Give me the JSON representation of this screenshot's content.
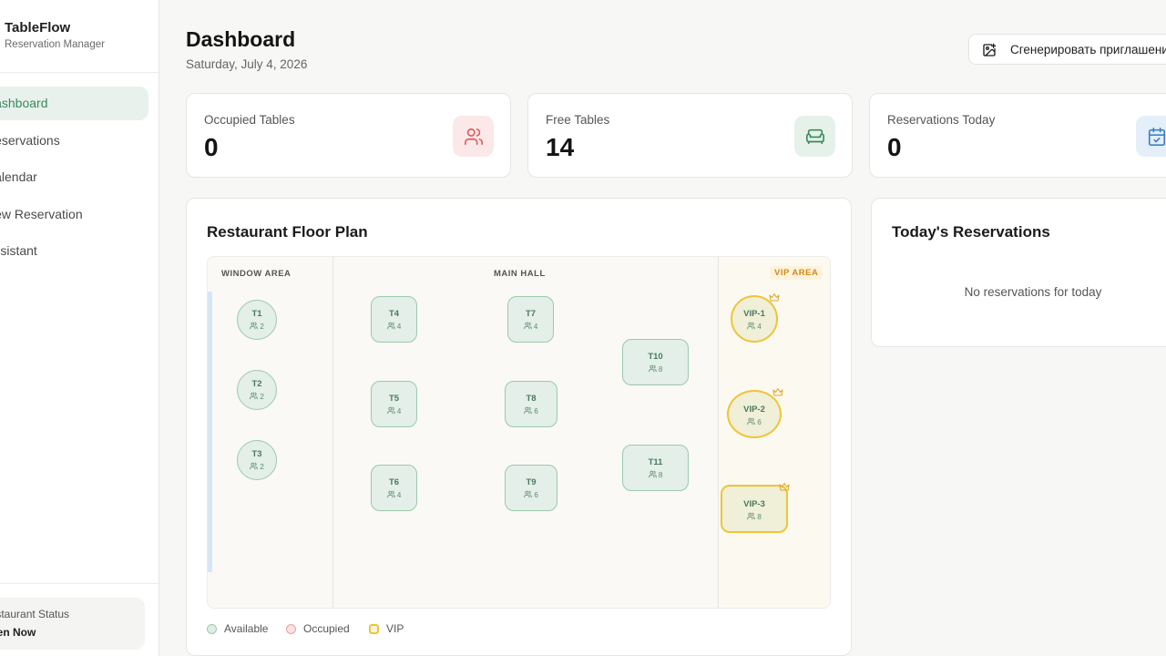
{
  "sidebar": {
    "brand_title": "TableFlow",
    "brand_subtitle": "Reservation Manager",
    "items": [
      {
        "label": "Dashboard",
        "active": true
      },
      {
        "label": "Reservations"
      },
      {
        "label": "Calendar"
      },
      {
        "label": "New Reservation"
      },
      {
        "label": "Assistant"
      }
    ],
    "status_label": "Restaurant Status",
    "status_value": "Open Now"
  },
  "header": {
    "title": "Dashboard",
    "date": "Saturday, July 4, 2026",
    "generate_button": "Сгенерировать приглашение"
  },
  "stats": [
    {
      "label": "Occupied Tables",
      "value": "0",
      "icon": "users-icon",
      "color": "#e05c5c"
    },
    {
      "label": "Free Tables",
      "value": "14",
      "icon": "sofa-icon",
      "color": "#3b8a5e"
    },
    {
      "label": "Reservations Today",
      "value": "0",
      "icon": "calendar-check-icon",
      "color": "#3b82c4"
    }
  ],
  "floor_plan": {
    "title": "Restaurant Floor Plan",
    "zones": {
      "window": "WINDOW AREA",
      "main": "MAIN HALL",
      "vip": "VIP AREA"
    },
    "tables": [
      {
        "name": "T1",
        "capacity": "2"
      },
      {
        "name": "T2",
        "capacity": "2"
      },
      {
        "name": "T3",
        "capacity": "2"
      },
      {
        "name": "T4",
        "capacity": "4"
      },
      {
        "name": "T5",
        "capacity": "4"
      },
      {
        "name": "T6",
        "capacity": "4"
      },
      {
        "name": "T7",
        "capacity": "4"
      },
      {
        "name": "T8",
        "capacity": "6"
      },
      {
        "name": "T9",
        "capacity": "6"
      },
      {
        "name": "T10",
        "capacity": "8"
      },
      {
        "name": "T11",
        "capacity": "8"
      },
      {
        "name": "VIP-1",
        "capacity": "4"
      },
      {
        "name": "VIP-2",
        "capacity": "6"
      },
      {
        "name": "VIP-3",
        "capacity": "8"
      }
    ],
    "legend": [
      {
        "label": "Available",
        "color": "#9cc9ae"
      },
      {
        "label": "Occupied",
        "color": "#e9a0a0"
      },
      {
        "label": "VIP",
        "color": "#f0c436"
      }
    ]
  },
  "reservations": {
    "title": "Today's Reservations",
    "empty": "No reservations for today"
  },
  "colors": {
    "accent": "#3b8a5e",
    "active_bg": "#e8f1ec",
    "vip": "#f0c436"
  }
}
